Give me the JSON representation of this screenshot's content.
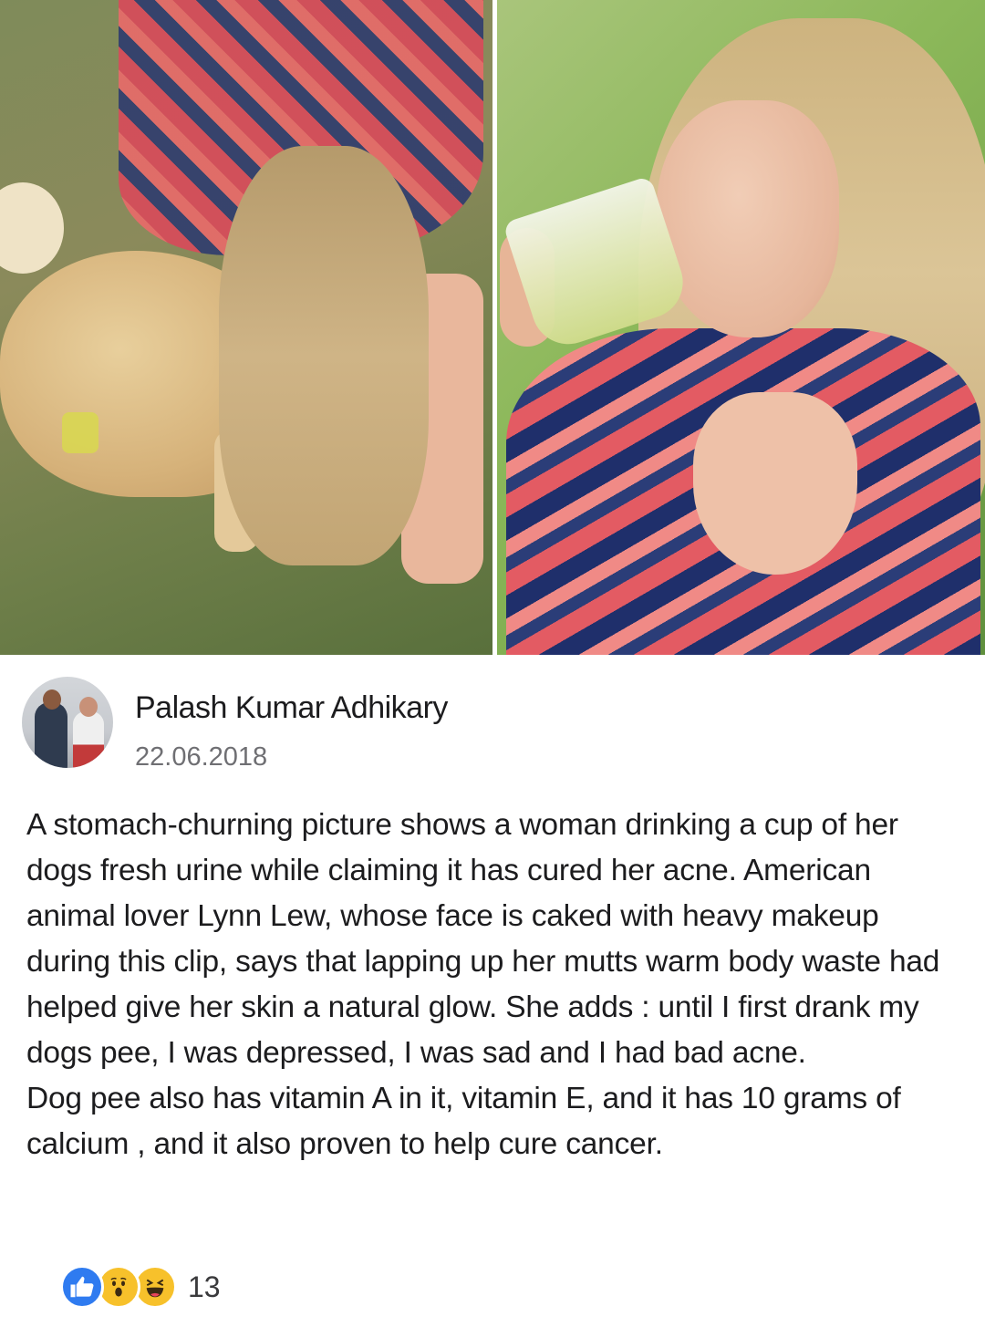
{
  "post": {
    "author_name": "Palash Kumar Adhikary",
    "date": "22.06.2018",
    "body_lines": [
      "A stomach-churning picture shows a woman drinking a cup of her dogs fresh urine while claiming it has cured her acne. American animal lover Lynn Lew, whose face is caked with heavy makeup during this clip, says that lapping up her mutts warm body waste had helped give her skin a natural glow. She adds : until I first drank my dogs pee, I was depressed, I was sad and I had bad acne.",
      "Dog pee also has vitamin A in it, vitamin E, and it has 10 grams of calcium , and it also proven to help cure cancer."
    ]
  },
  "reactions": {
    "icons": [
      "like-icon",
      "wow-icon",
      "haha-icon"
    ],
    "count": "13",
    "colors": {
      "like": "#2f7bf0",
      "wow": "#f7c12b",
      "haha": "#f7c12b"
    }
  }
}
